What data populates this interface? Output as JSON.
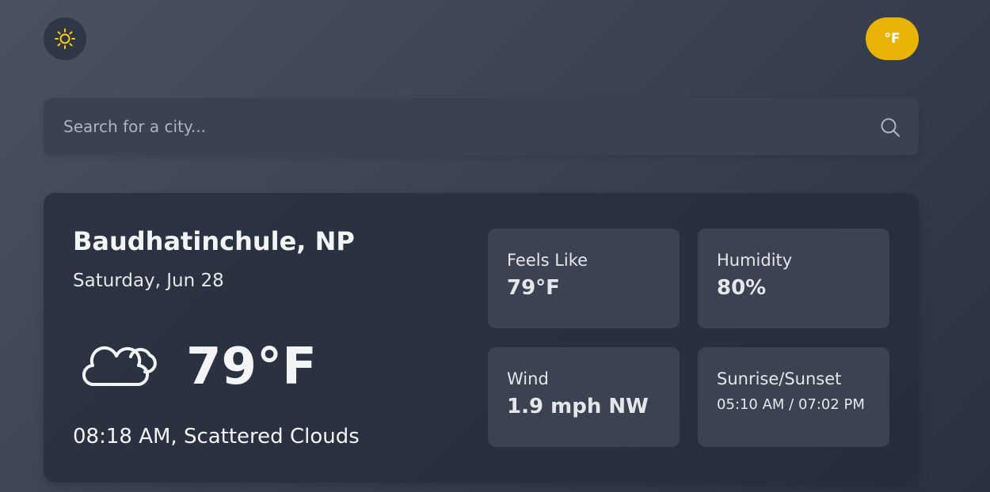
{
  "header": {
    "theme_icon": "sun-icon",
    "unit_toggle_label": "°F",
    "accent_color": "#eab308"
  },
  "search": {
    "placeholder": "Search for a city...",
    "value": "",
    "icon": "search-icon"
  },
  "weather": {
    "city": "Baudhatinchule, NP",
    "date": "Saturday, Jun 28",
    "condition_icon": "cloud-icon",
    "temperature": "79°F",
    "time_and_description": "08:18 AM, Scattered Clouds"
  },
  "stats": {
    "feels_like": {
      "label": "Feels Like",
      "value": "79°F"
    },
    "humidity": {
      "label": "Humidity",
      "value": "80%"
    },
    "wind": {
      "label": "Wind",
      "value": "1.9 mph NW"
    },
    "sunrise_sunset": {
      "label": "Sunrise/Sunset",
      "value": "05:10 AM / 07:02 PM"
    }
  }
}
